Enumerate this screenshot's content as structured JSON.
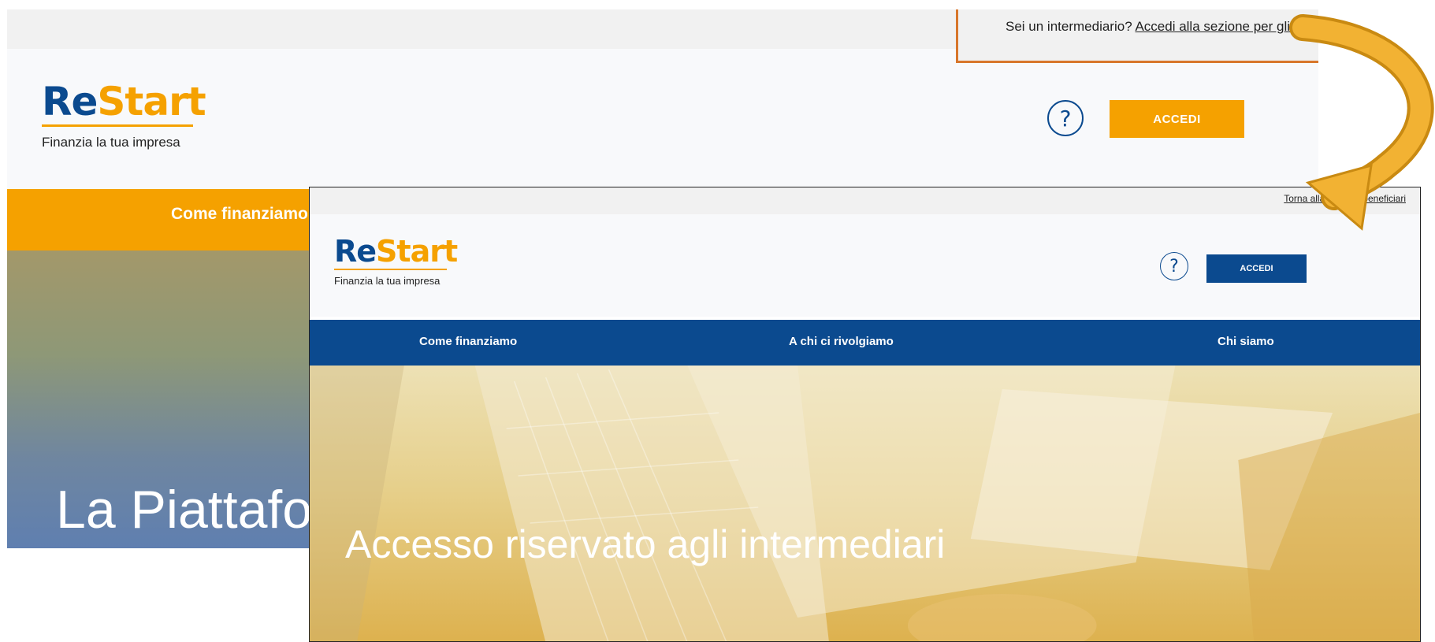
{
  "background_page": {
    "topbar": {
      "intermediary_prompt": "Sei un intermediario?",
      "intermediary_link": "Accedi alla sezione per gli int"
    },
    "logo": {
      "word_re": "Re",
      "word_start": "Start",
      "tagline": "Finanzia la tua impresa"
    },
    "help_icon": "?",
    "login_button": "ACCEDI",
    "nav": {
      "item_1": "Come finanziamo"
    },
    "hero_title": "La Piattafo",
    "colors": {
      "accent": "#f5a100",
      "brand_blue": "#0b4a8f"
    }
  },
  "foreground_page": {
    "topbar": {
      "back_link": "Torna alla sezione beneficiari"
    },
    "logo": {
      "word_re": "Re",
      "word_start": "Start",
      "tagline": "Finanzia la tua impresa"
    },
    "help_icon": "?",
    "login_button": "ACCEDI",
    "nav": {
      "items": [
        "Come finanziamo",
        "A chi ci rivolgiamo",
        "Chi siamo"
      ]
    },
    "hero_title": "Accesso riservato agli intermediari",
    "colors": {
      "nav_bg": "#0b4a8f",
      "hero_tint": "#e6c46a"
    }
  },
  "annotation": {
    "arrow_color": "#e5a21a",
    "highlight_color": "#d8762b"
  }
}
